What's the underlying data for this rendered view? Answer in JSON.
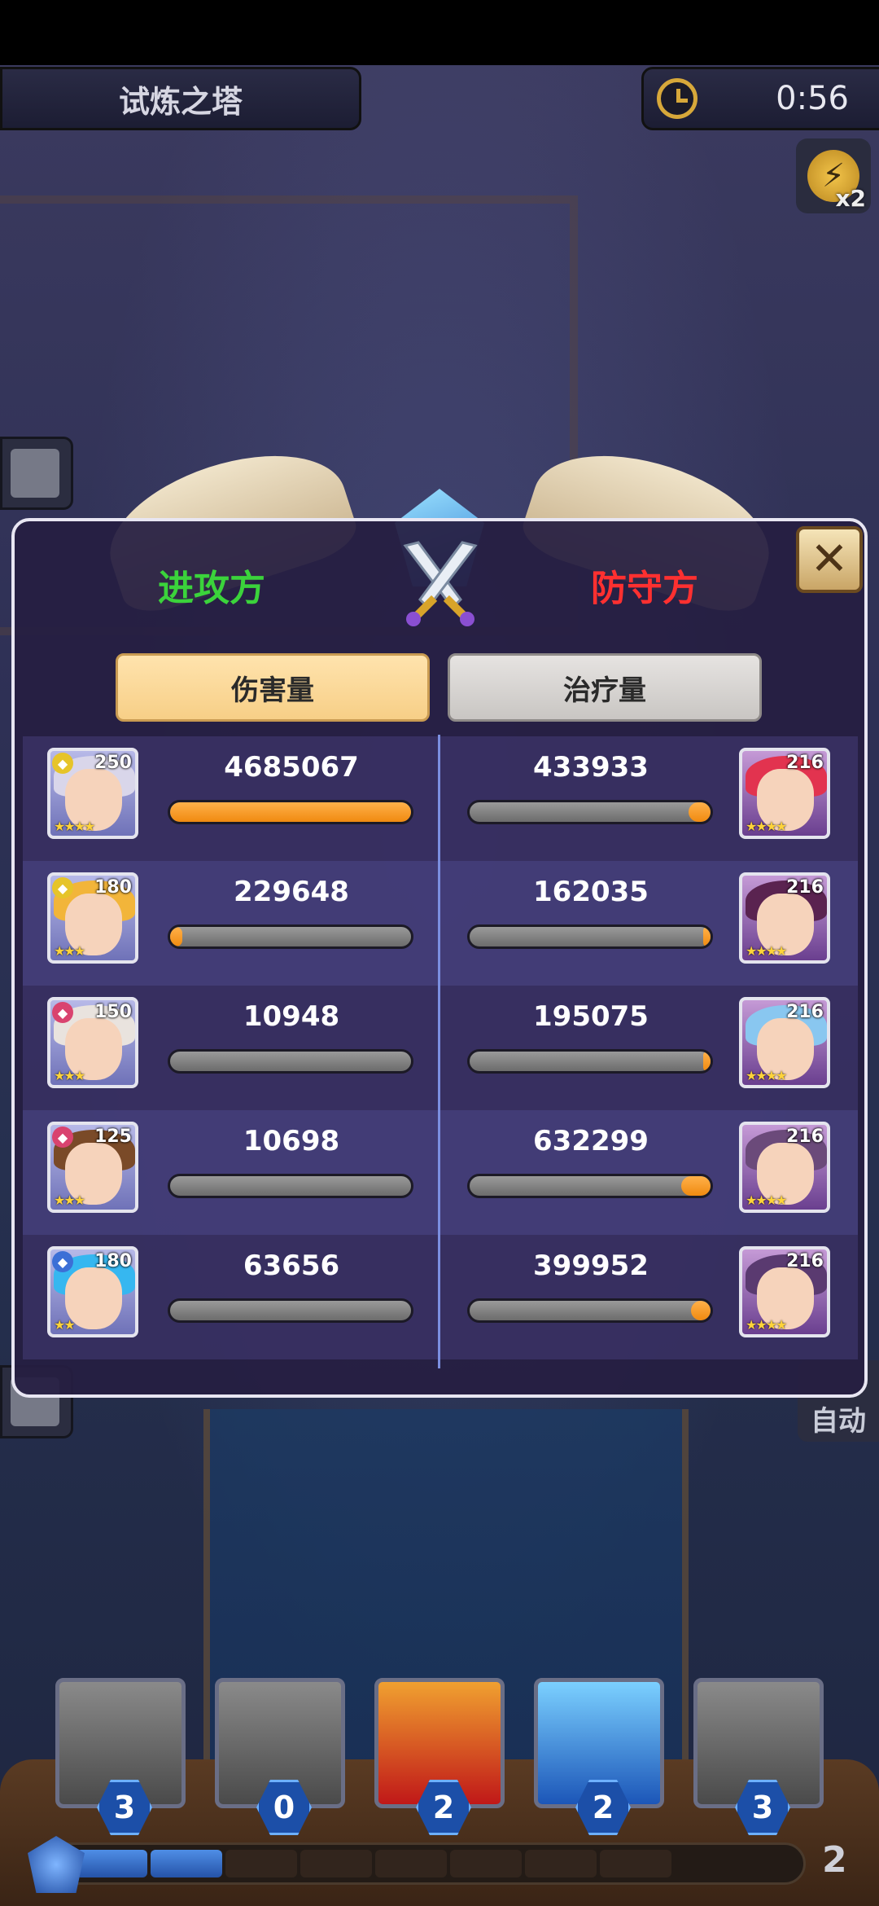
{
  "header": {
    "title": "试炼之塔",
    "timer": "0:56",
    "speed": "x2"
  },
  "side": {
    "auto_label": "自动"
  },
  "dialog": {
    "attacker_label": "进攻方",
    "defender_label": "防守方",
    "tabs": [
      {
        "label": "伤害量",
        "active": true
      },
      {
        "label": "治疗量",
        "active": false
      }
    ],
    "rows": [
      {
        "attacker": {
          "level": "250",
          "value": "4685067",
          "fill": 1.0,
          "hair": "#d9d6ea",
          "faction": "#e6c42a",
          "stars": "★★★★"
        },
        "defender": {
          "level": "216",
          "value": "433933",
          "fill": 0.09,
          "hair": "#e2334f",
          "stars": "★★★★"
        }
      },
      {
        "attacker": {
          "level": "180",
          "value": "229648",
          "fill": 0.05,
          "hair": "#f2b53a",
          "faction": "#e6c42a",
          "stars": "★★★"
        },
        "defender": {
          "level": "216",
          "value": "162035",
          "fill": 0.03,
          "hair": "#5a2350",
          "stars": "★★★★"
        }
      },
      {
        "attacker": {
          "level": "150",
          "value": "10948",
          "fill": 0.0,
          "hair": "#e9e3de",
          "faction": "#d9436f",
          "stars": "★★★"
        },
        "defender": {
          "level": "216",
          "value": "195075",
          "fill": 0.03,
          "hair": "#89c7f0",
          "stars": "★★★★"
        }
      },
      {
        "attacker": {
          "level": "125",
          "value": "10698",
          "fill": 0.0,
          "hair": "#7a4a28",
          "faction": "#d9436f",
          "stars": "★★★"
        },
        "defender": {
          "level": "216",
          "value": "632299",
          "fill": 0.12,
          "hair": "#6b4a7a",
          "stars": "★★★★"
        }
      },
      {
        "attacker": {
          "level": "180",
          "value": "63656",
          "fill": 0.0,
          "hair": "#36b7f0",
          "faction": "#3c6fd6",
          "stars": "★★"
        },
        "defender": {
          "level": "216",
          "value": "399952",
          "fill": 0.08,
          "hair": "#5a3a70",
          "stars": "★★★★"
        }
      }
    ]
  },
  "skills": [
    {
      "count": "3",
      "style": "gray"
    },
    {
      "count": "0",
      "style": "gray"
    },
    {
      "count": "2",
      "style": "red"
    },
    {
      "count": "2",
      "style": "blue"
    },
    {
      "count": "3",
      "style": "gray"
    }
  ],
  "energy": {
    "count": "2",
    "filled_segments": 2,
    "total_segments": 8
  },
  "colors": {
    "attacker": "#3bd33b",
    "defender": "#ff3030",
    "bar_fill": "#f08a10"
  }
}
